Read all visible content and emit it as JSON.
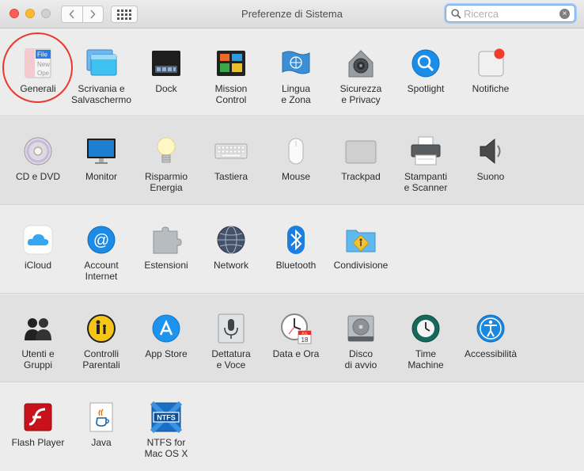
{
  "window": {
    "title": "Preferenze di Sistema"
  },
  "search": {
    "placeholder": "Ricerca",
    "value": ""
  },
  "sections": [
    {
      "items": [
        "Generali",
        "Scrivania e\nSalvaschermo",
        "Dock",
        "Mission\nControl",
        "Lingua\ne Zona",
        "Sicurezza\ne Privacy",
        "Spotlight",
        "Notifiche"
      ]
    },
    {
      "items": [
        "CD e DVD",
        "Monitor",
        "Risparmio\nEnergia",
        "Tastiera",
        "Mouse",
        "Trackpad",
        "Stampanti\ne Scanner",
        "Suono"
      ]
    },
    {
      "items": [
        "iCloud",
        "Account\nInternet",
        "Estensioni",
        "Network",
        "Bluetooth",
        "Condivisione"
      ]
    },
    {
      "items": [
        "Utenti e\nGruppi",
        "Controlli\nParentali",
        "App Store",
        "Dettatura\ne Voce",
        "Data e Ora",
        "Disco\ndi avvio",
        "Time\nMachine",
        "Accessibilità"
      ]
    },
    {
      "items": [
        "Flash Player",
        "Java",
        "NTFS for\nMac OS X"
      ]
    }
  ],
  "icon_text": {
    "generali": {
      "file": "File",
      "new": "New",
      "open": "Ope"
    },
    "datetime": {
      "month": "JUL",
      "day": "18"
    },
    "ntfs": "NTFS"
  },
  "colors": {
    "highlight_circle": "#e8392f",
    "traffic_close": "#fc5f57",
    "traffic_min": "#fdbc2e",
    "search_focus": "#6ea6e6"
  }
}
